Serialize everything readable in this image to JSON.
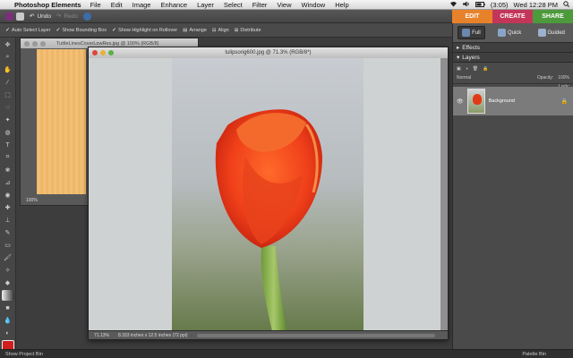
{
  "menubar": {
    "app_name": "Photoshop Elements",
    "items": [
      "File",
      "Edit",
      "Image",
      "Enhance",
      "Layer",
      "Select",
      "Filter",
      "View",
      "Window",
      "Help"
    ],
    "battery": "(3:05)",
    "clock": "Wed 12:28 PM"
  },
  "appbar": {
    "undo": "Undo",
    "redo": "Redo"
  },
  "modes": [
    {
      "label": "EDIT",
      "color": "#e8822a"
    },
    {
      "label": "CREATE",
      "color": "#c3365a"
    },
    {
      "label": "SHARE",
      "color": "#4d9a3c"
    }
  ],
  "options": {
    "auto_select": "Auto Select Layer",
    "bounding_box": "Show Bounding Box",
    "highlight": "Show Highlight on Rollover",
    "arrange": "Arrange",
    "align": "Align",
    "distribute": "Distribute"
  },
  "doc_back": {
    "title": "TuttleLinesCoverLowRes.jpg @ 100% (RGB/8)",
    "zoom": "100%"
  },
  "doc_front": {
    "title": "tulipsorig600.jpg @ 71.3% (RGB/8*)",
    "zoom": "71.13%",
    "size": "8.333 inches x 12.5 inches (72 ppi)"
  },
  "view_tabs": [
    {
      "label": "Full",
      "icon": "full-edit-icon"
    },
    {
      "label": "Quick",
      "icon": "quick-edit-icon"
    },
    {
      "label": "Guided",
      "icon": "guided-edit-icon"
    }
  ],
  "panels": {
    "effects": "Effects",
    "layers": "Layers",
    "blend_mode": "Normal",
    "opacity_label": "Opacity:",
    "opacity_value": "100%",
    "lock_label": "Lock:",
    "layer_name": "Background"
  },
  "bottombar": {
    "project_bin": "Show Project Bin",
    "palette_bin": "Palette Bin"
  }
}
